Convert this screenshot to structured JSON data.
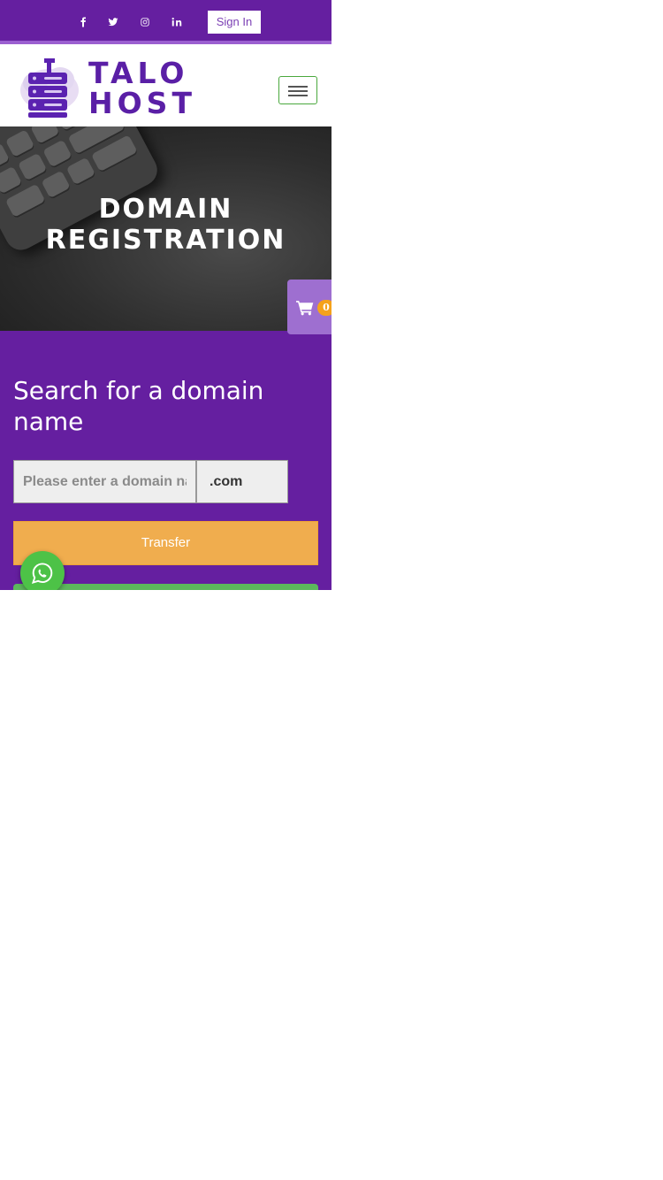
{
  "topbar": {
    "social_icons": [
      "facebook-icon",
      "twitter-icon",
      "instagram-icon",
      "linkedin-icon"
    ],
    "signin_label": "Sign In"
  },
  "header": {
    "logo_line1": "TALO",
    "logo_line2": "HOST",
    "menu_icon": "hamburger-icon"
  },
  "hero": {
    "title_line1": "DOMAIN",
    "title_line2": "REGISTRATION"
  },
  "cart": {
    "icon": "cart-icon",
    "count": "0"
  },
  "search": {
    "title": "Search for a domain name",
    "input_placeholder": "Please enter a domain name",
    "tld_value": ".com",
    "transfer_label": "Transfer"
  },
  "whatsapp": {
    "icon": "whatsapp-icon"
  },
  "colors": {
    "primary_purple": "#651fa0",
    "accent_orange": "#f0ad4e",
    "accent_green": "#5cb85c",
    "cart_purple": "#9e6fd0",
    "badge_orange": "#f5a21b",
    "whatsapp_green": "#4dc247"
  }
}
